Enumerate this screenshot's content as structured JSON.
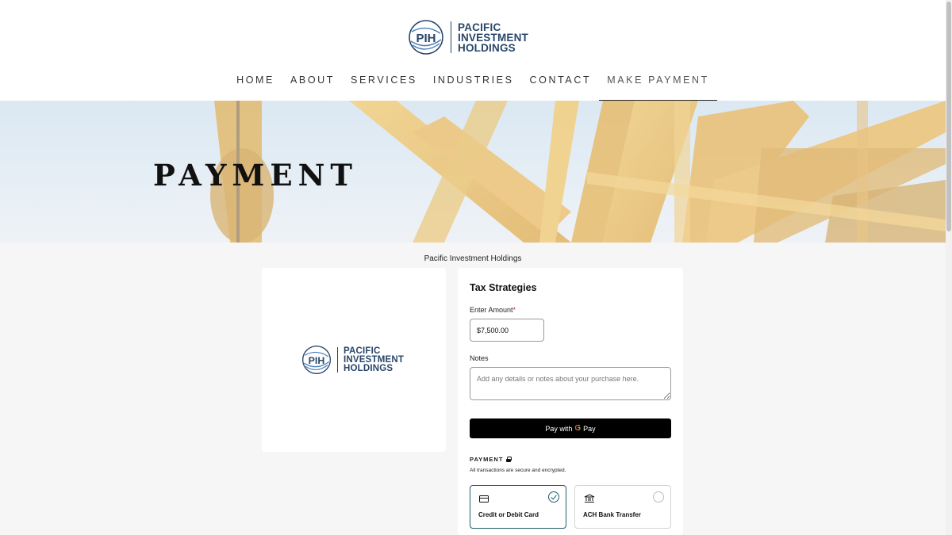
{
  "brand": {
    "logo_letters": "PIH",
    "line1": "PACIFIC",
    "line2": "INVESTMENT",
    "line3": "HOLDINGS",
    "color": "#29466b"
  },
  "nav": {
    "items": [
      {
        "label": "HOME"
      },
      {
        "label": "ABOUT"
      },
      {
        "label": "SERVICES"
      },
      {
        "label": "INDUSTRIES"
      },
      {
        "label": "CONTACT"
      },
      {
        "label": "MAKE PAYMENT",
        "active": true
      }
    ]
  },
  "hero": {
    "title": "PAYMENT"
  },
  "page": {
    "business_name": "Pacific Investment Holdings"
  },
  "form": {
    "title": "Tax Strategies",
    "amount_label": "Enter Amount",
    "amount_required_mark": "*",
    "amount_value": "$7,500.00",
    "notes_label": "Notes",
    "notes_placeholder": "Add any details or notes about your purchase here.",
    "gpay_prefix": "Pay with",
    "gpay_g": "G",
    "gpay_suffix": "Pay",
    "payment_heading": "PAYMENT",
    "payment_subtext": "All transactions are secure and encrypted.",
    "methods": [
      {
        "label": "Credit or Debit Card",
        "icon": "credit-card-icon",
        "selected": true
      },
      {
        "label": "ACH Bank Transfer",
        "icon": "bank-icon",
        "selected": false
      }
    ]
  },
  "colors": {
    "selected_accent": "#1d5e6a",
    "button_bg": "#000000"
  }
}
